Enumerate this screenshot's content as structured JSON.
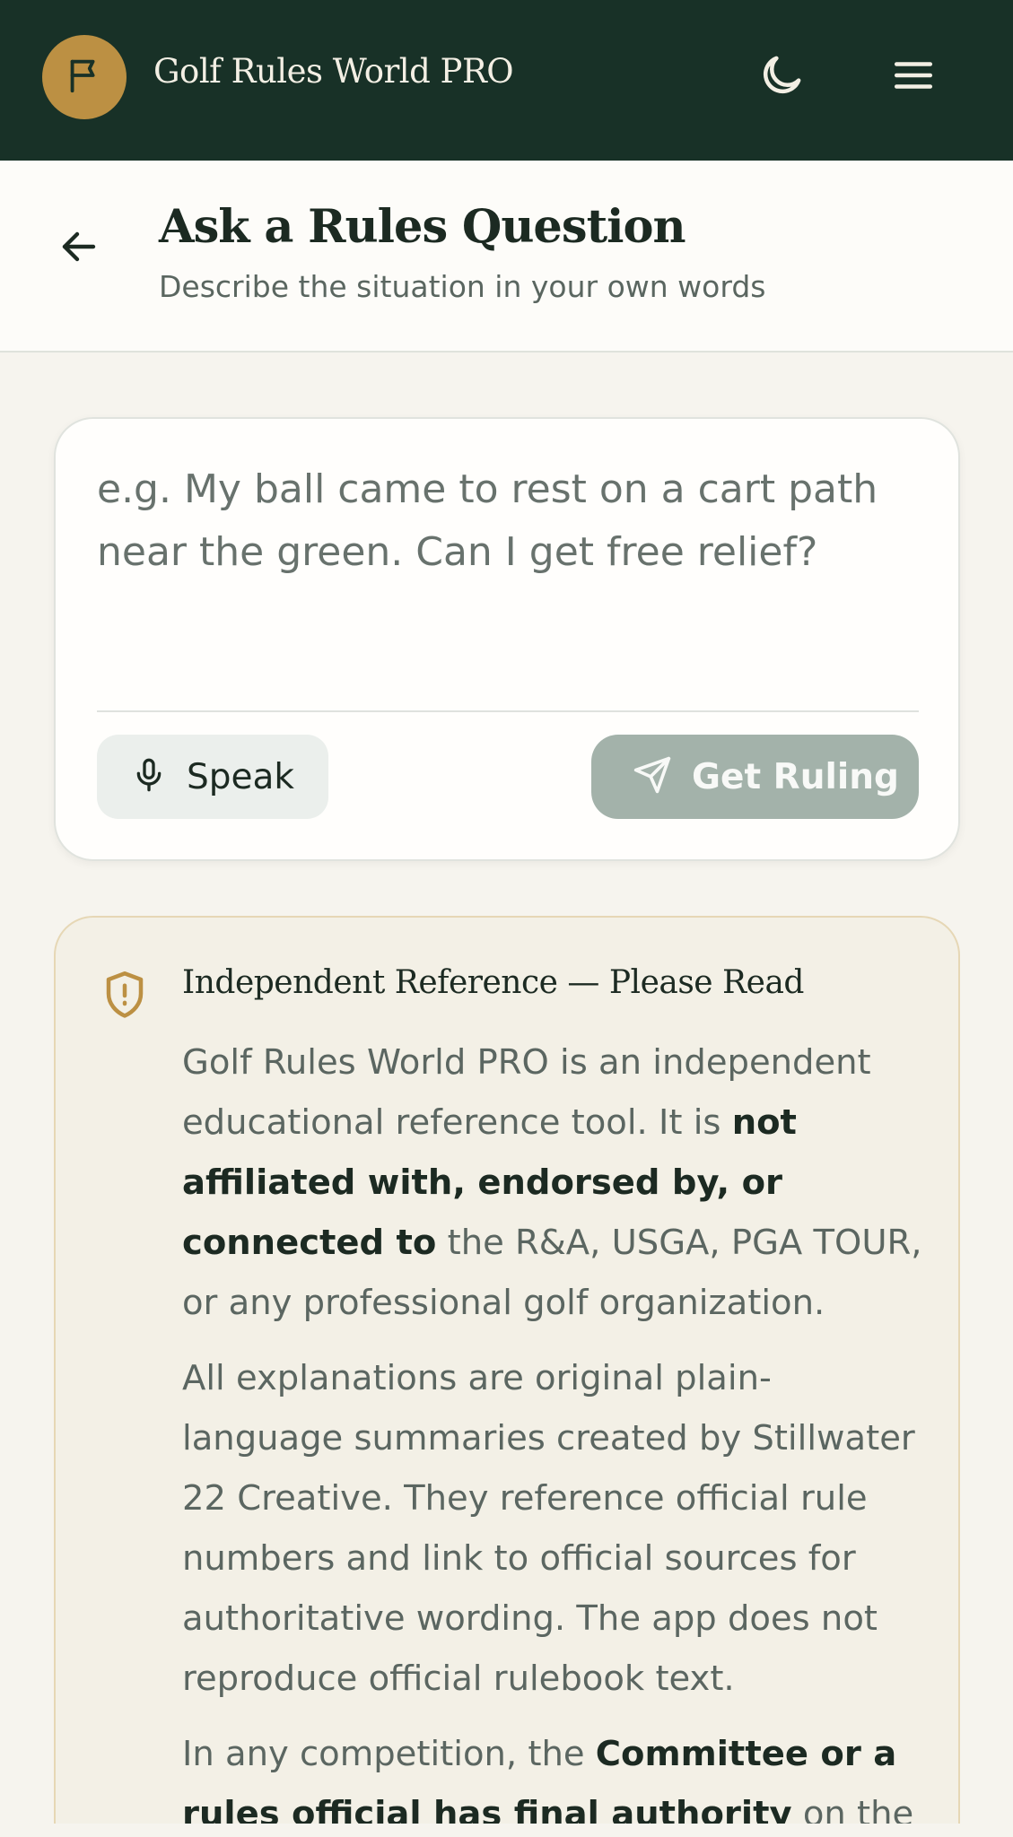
{
  "app": {
    "title": "Golf Rules World PRO"
  },
  "header_icons": {
    "logo": "flag-icon",
    "theme_toggle": "moon-icon",
    "menu": "hamburger-menu-icon"
  },
  "page": {
    "title": "Ask a Rules Question",
    "subtitle": "Describe the situation in your own words",
    "back_icon": "arrow-left-icon"
  },
  "question": {
    "value": "",
    "placeholder": "e.g. My ball came to rest on a cart path near the green. Can I get free relief?",
    "speak_label": "Speak",
    "speak_icon": "microphone-icon",
    "submit_label": "Get Ruling",
    "submit_icon": "send-icon",
    "submit_enabled": false
  },
  "notice": {
    "icon": "shield-alert-icon",
    "title": "Independent Reference — Please Read",
    "p1_a": "Golf Rules World PRO is an independent educational reference tool. It is ",
    "p1_b": "not affiliated with, endorsed by, or connected to",
    "p1_c": " the R&A, USGA, PGA TOUR, or any professional golf organization.",
    "p2": "All explanations are original plain-language summaries created by Stillwater 22 Creative. They reference official rule numbers and link to official sources for authoritative wording. The app does not reproduce official rulebook text.",
    "p3_a": "In any competition, the ",
    "p3_b": "Committee or a rules official has final authority",
    "p3_c": " on the"
  },
  "colors": {
    "header_bg": "#183127",
    "accent_gold": "#bc9043",
    "page_bg": "#f6f4ee",
    "button_disabled": "#a3b2aa"
  }
}
